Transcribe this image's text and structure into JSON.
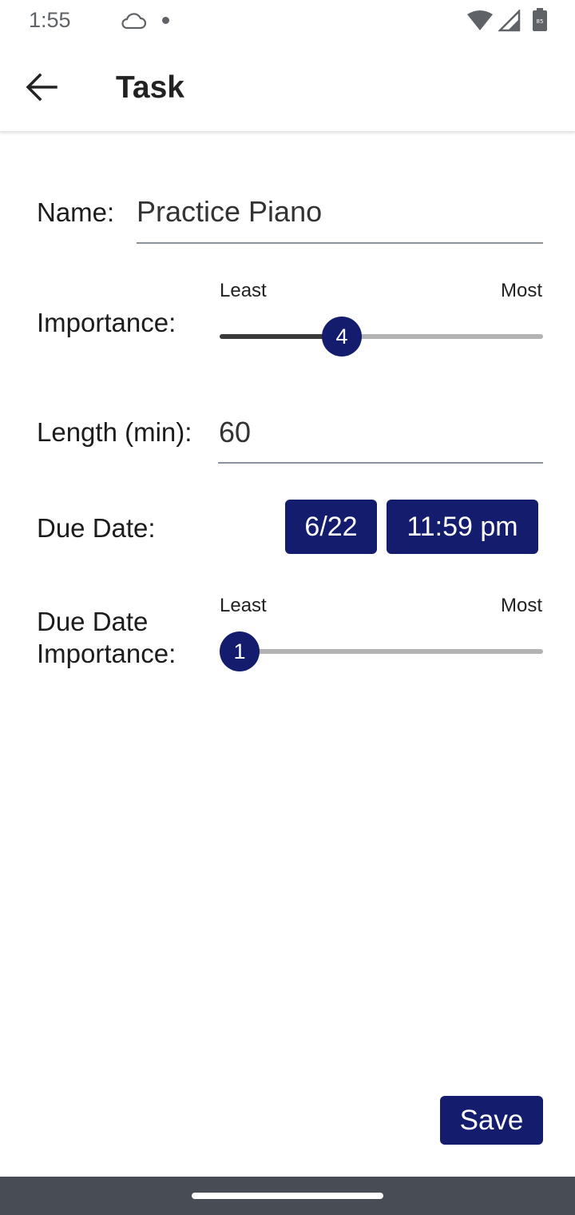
{
  "status_bar": {
    "time": "1:55",
    "battery_level": "85",
    "icons": [
      "cloud-icon",
      "notification-dot-icon",
      "wifi-icon",
      "signal-icon",
      "battery-icon"
    ]
  },
  "app_bar": {
    "title": "Task",
    "back_icon": "arrow-left-icon"
  },
  "form": {
    "name": {
      "label": "Name:",
      "value": "Practice Piano"
    },
    "importance": {
      "label": "Importance:",
      "min_label": "Least",
      "max_label": "Most",
      "value": "4",
      "fraction": 0.36
    },
    "length": {
      "label": "Length (min):",
      "value": "60"
    },
    "due_date": {
      "label": "Due Date:",
      "date_button": "6/22",
      "time_button": "11:59 pm"
    },
    "due_date_importance": {
      "label_line1": "Due Date",
      "label_line2": "Importance:",
      "min_label": "Least",
      "max_label": "Most",
      "value": "1",
      "fraction": 0.0
    }
  },
  "save_label": "Save",
  "colors": {
    "accent": "#141c6e",
    "track_inactive": "#b3b3b3",
    "track_active": "#3a3a3a",
    "nav_bar": "#484d55"
  }
}
